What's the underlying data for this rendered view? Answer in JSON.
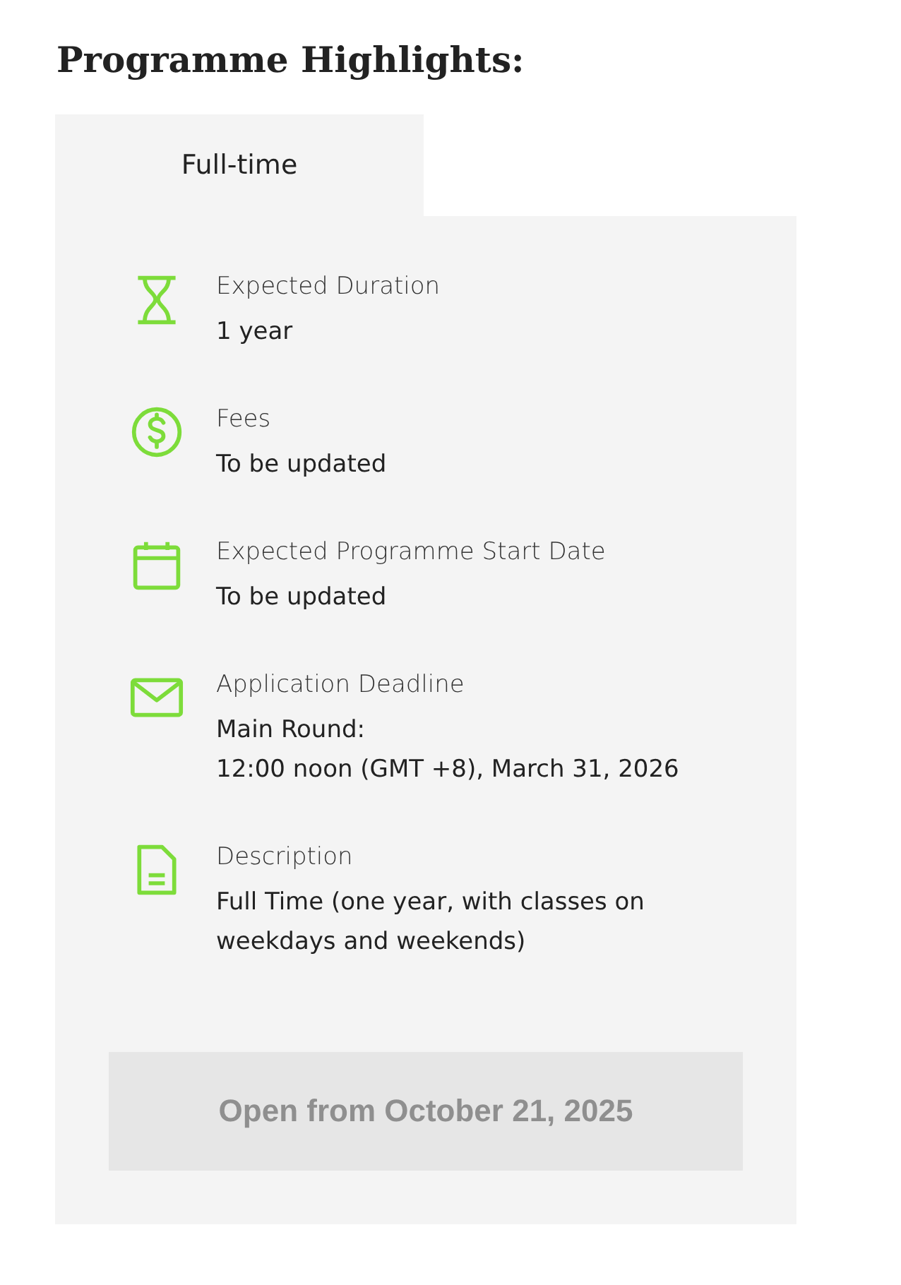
{
  "heading": "Programme Highlights:",
  "tabs": [
    {
      "label": "Full-time",
      "selected": true
    }
  ],
  "highlights": [
    {
      "kind": "hourglass",
      "label": "Expected Duration",
      "lines": [
        "1 year"
      ]
    },
    {
      "kind": "dollar",
      "label": "Fees",
      "lines": [
        "To be updated"
      ]
    },
    {
      "kind": "calendar",
      "label": "Expected Programme Start Date",
      "lines": [
        "To be updated"
      ]
    },
    {
      "kind": "mail",
      "label": "Application Deadline",
      "lines": [
        "Main Round:",
        "12:00 noon (GMT +8), March 31, 2026"
      ]
    },
    {
      "kind": "document",
      "label": "Description",
      "lines": [
        "Full Time (one year, with classes on weekdays and weekends)"
      ]
    }
  ],
  "button": {
    "label": "Open from October 21, 2025",
    "disabled": true
  }
}
